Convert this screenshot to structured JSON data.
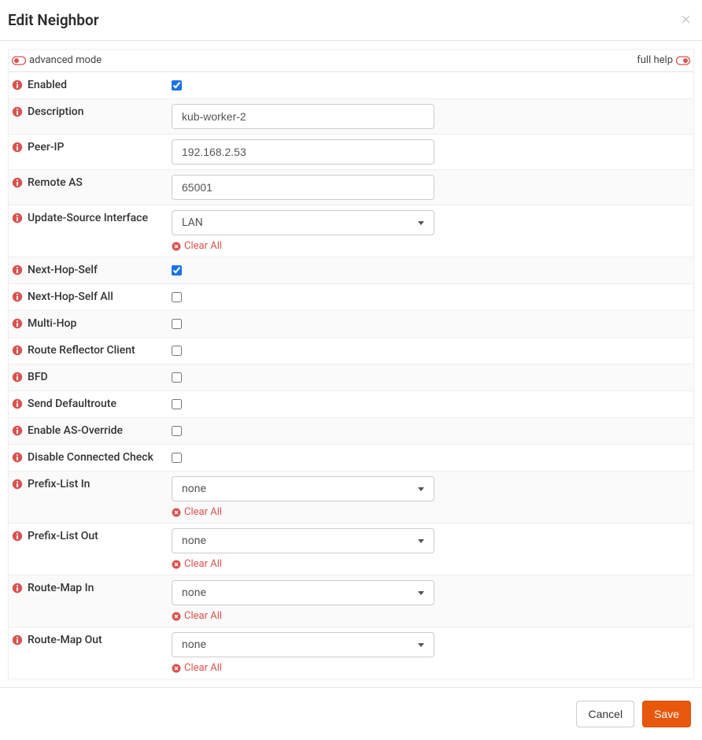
{
  "header": {
    "title": "Edit Neighbor"
  },
  "toggles": {
    "advanced_label": "advanced mode",
    "full_help_label": "full help"
  },
  "fields": {
    "enabled": {
      "label": "Enabled",
      "checked": true
    },
    "description": {
      "label": "Description",
      "value": "kub-worker-2"
    },
    "peer_ip": {
      "label": "Peer-IP",
      "value": "192.168.2.53"
    },
    "remote_as": {
      "label": "Remote AS",
      "value": "65001"
    },
    "update_source": {
      "label": "Update-Source Interface",
      "selected": "LAN"
    },
    "next_hop_self": {
      "label": "Next-Hop-Self",
      "checked": true
    },
    "next_hop_self_all": {
      "label": "Next-Hop-Self All",
      "checked": false
    },
    "multi_hop": {
      "label": "Multi-Hop",
      "checked": false
    },
    "route_reflector": {
      "label": "Route Reflector Client",
      "checked": false
    },
    "bfd": {
      "label": "BFD",
      "checked": false
    },
    "send_defaultroute": {
      "label": "Send Defaultroute",
      "checked": false
    },
    "enable_as_override": {
      "label": "Enable AS-Override",
      "checked": false
    },
    "disable_connected_check": {
      "label": "Disable Connected Check",
      "checked": false
    },
    "prefix_list_in": {
      "label": "Prefix-List In",
      "selected": "none"
    },
    "prefix_list_out": {
      "label": "Prefix-List Out",
      "selected": "none"
    },
    "route_map_in": {
      "label": "Route-Map In",
      "selected": "none"
    },
    "route_map_out": {
      "label": "Route-Map Out",
      "selected": "none"
    }
  },
  "actions": {
    "clear_all": "Clear All",
    "cancel": "Cancel",
    "save": "Save"
  }
}
